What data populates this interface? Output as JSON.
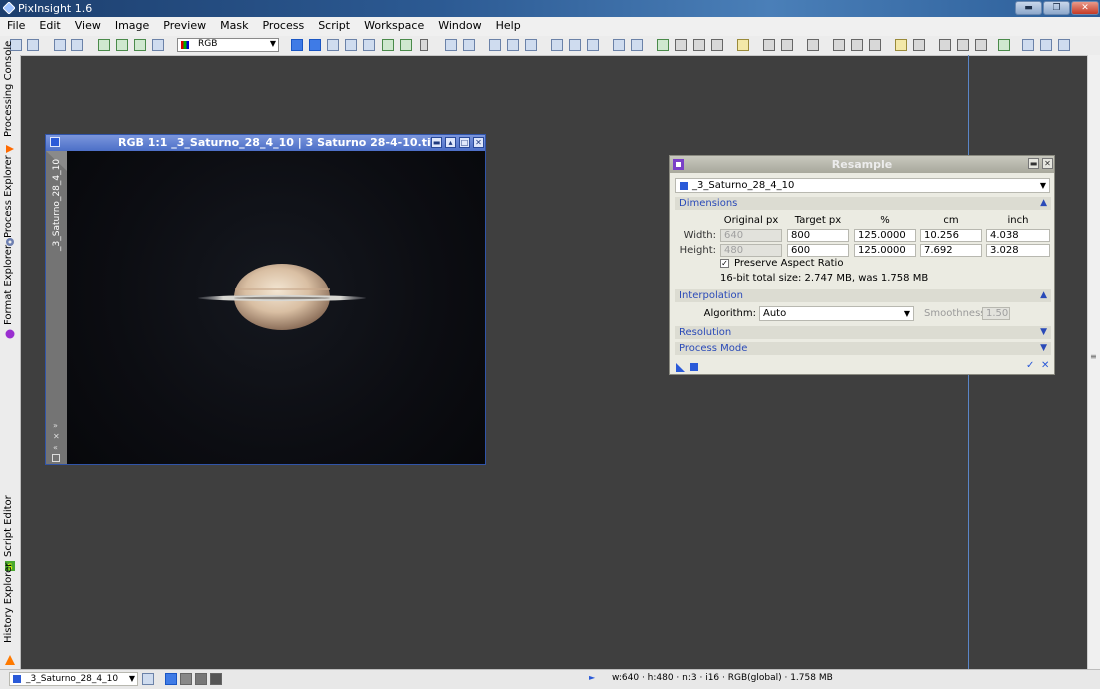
{
  "window": {
    "title": "PixInsight 1.6",
    "min": "▬",
    "max": "❐",
    "close": "✕"
  },
  "menu": [
    "File",
    "Edit",
    "View",
    "Image",
    "Preview",
    "Mask",
    "Process",
    "Script",
    "Workspace",
    "Window",
    "Help"
  ],
  "toolbar": {
    "channel_select": "RGB"
  },
  "sidebar": {
    "tabs": [
      {
        "label": "Processing Console",
        "icon": "play-icon"
      },
      {
        "label": "Process Explorer",
        "icon": "gear-icon"
      },
      {
        "label": "Format Explorer",
        "icon": "sphere-icon"
      },
      {
        "label": "Script Editor",
        "icon": "script-icon"
      },
      {
        "label": "History Explorer",
        "icon": "history-icon"
      }
    ]
  },
  "image_window": {
    "title": "RGB 1:1 _3_Saturno_28_4_10 | 3 Saturno 28-4-10.tif",
    "side_label": "_3_Saturno_28_4_10"
  },
  "resample": {
    "title": "Resample",
    "view": "_3_Saturno_28_4_10",
    "dimensions": {
      "label": "Dimensions",
      "columns": [
        "Original px",
        "Target px",
        "%",
        "cm",
        "inch"
      ],
      "width": {
        "label": "Width:",
        "original": "640",
        "target": "800",
        "percent": "125.0000",
        "cm": "10.256",
        "inch": "4.038"
      },
      "height": {
        "label": "Height:",
        "original": "480",
        "target": "600",
        "percent": "125.0000",
        "cm": "7.692",
        "inch": "3.028"
      },
      "preserve_aspect": "Preserve Aspect Ratio",
      "size_info": "16-bit total size: 2.747 MB, was 1.758 MB"
    },
    "interpolation": {
      "label": "Interpolation",
      "algorithm_label": "Algorithm:",
      "algorithm": "Auto",
      "smoothness_label": "Smoothness:",
      "smoothness": "1.50"
    },
    "resolution": {
      "label": "Resolution"
    },
    "process_mode": {
      "label": "Process Mode"
    }
  },
  "statusbar": {
    "view": "_3_Saturno_28_4_10",
    "info": "w:640 · h:480 · n:3 · i16 · RGB(global) · 1.758 MB"
  }
}
